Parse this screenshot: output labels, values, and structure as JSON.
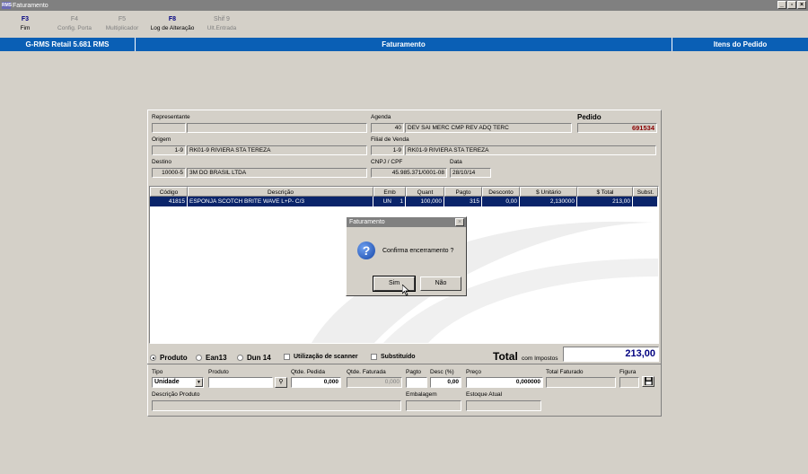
{
  "window": {
    "icon_text": "RMS",
    "title": "Faturamento"
  },
  "toolbar": [
    {
      "key": "F3",
      "label": "Fim",
      "enabled": true
    },
    {
      "key": "F4",
      "label": "Config. Porta",
      "enabled": false
    },
    {
      "key": "F5",
      "label": "Multiplicador",
      "enabled": false
    },
    {
      "key": "F8",
      "label": "Log de Alteração",
      "enabled": true
    },
    {
      "key": "Shif 9",
      "label": "Ult.Entrada",
      "enabled": false
    }
  ],
  "bluebar": {
    "left": "G-RMS Retail 5.681 RMS",
    "center": "Faturamento",
    "right": "Itens do Pedido"
  },
  "header": {
    "representante_label": "Representante",
    "representante_code": "",
    "representante_name": "",
    "agenda_label": "Agenda",
    "agenda_code": "40",
    "agenda_desc": "DEV SAI MERC CMP REV ADQ TERC",
    "pedido_label": "Pedido",
    "pedido_value": "691534",
    "origem_label": "Origem",
    "origem_code": "1-9",
    "origem_name": "RK01-9 RIVIERA STA TEREZA",
    "filial_label": "Filial de Venda",
    "filial_code": "1-9",
    "filial_name": "RK01-9 RIVIERA STA TEREZA",
    "destino_label": "Destino",
    "destino_code": "10000-5",
    "destino_name": "3M DO BRASIL LTDA",
    "cnpj_label": "CNPJ / CPF",
    "cnpj_value": "45.985.371/0001-08",
    "data_label": "Data",
    "data_value": "28/10/14"
  },
  "grid": {
    "columns": [
      "Código",
      "Descrição",
      "Emb",
      "Quant",
      "Pagto",
      "Desconto",
      "$ Unitário",
      "$ Total",
      "Subst."
    ],
    "rows": [
      {
        "codigo": "41815",
        "descricao": "ESPONJA SCOTCH BRITE WAVE L+P- C/3",
        "emb": "UN",
        "emb_qty": "1",
        "quant": "100,000",
        "pagto": "315",
        "desconto": "0,00",
        "unitario": "2,130000",
        "total": "213,00",
        "subst": ""
      }
    ]
  },
  "dialog": {
    "title": "Faturamento",
    "message": "Confirma encerramento ?",
    "yes": "Sim",
    "no": "Não"
  },
  "options": {
    "produto": "Produto",
    "ean13": "Ean13",
    "dun14": "Dun 14",
    "scanner": "Utilização de scanner",
    "substituido": "Substituído"
  },
  "total": {
    "label": "Total",
    "sub": "com Impostos",
    "value": "213,00"
  },
  "entry": {
    "tipo_label": "Tipo",
    "tipo_value": "Unidade",
    "produto_label": "Produto",
    "produto_value": "",
    "qtde_pedida_label": "Qtde. Pedida",
    "qtde_pedida_value": "0,000",
    "qtde_faturada_label": "Qtde. Faturada",
    "qtde_faturada_value": "0,000",
    "pagto_label": "Pagto",
    "pagto_value": "",
    "desc_label": "Desc (%)",
    "desc_value": "0,00",
    "preco_label": "Preço",
    "preco_value": "0,000000",
    "total_faturado_label": "Total Faturado",
    "total_faturado_value": "",
    "figura_label": "Figura",
    "descricao_label": "Descrição Produto",
    "descricao_value": "",
    "embalagem_label": "Embalagem",
    "embalagem_value": "",
    "estoque_label": "Estoque Atual",
    "estoque_value": ""
  }
}
